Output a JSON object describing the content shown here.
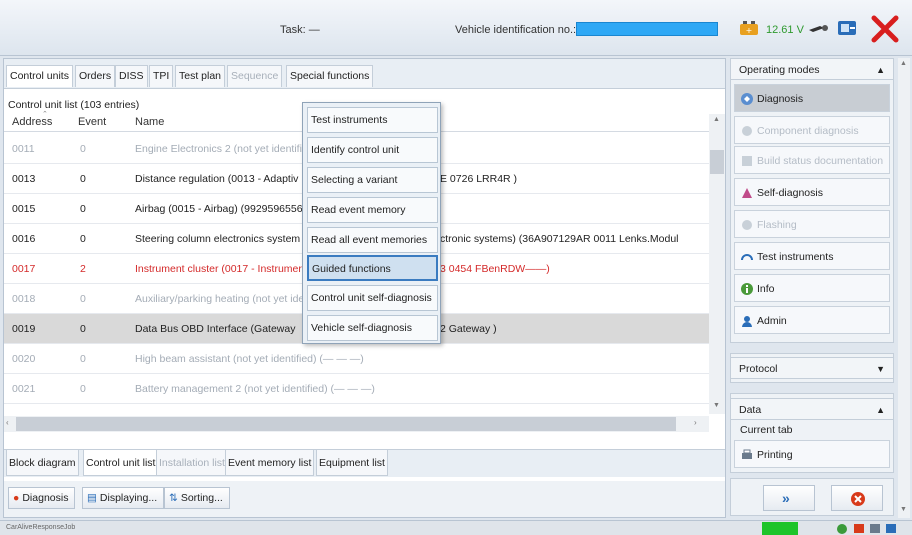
{
  "topbar": {
    "task_label": "Task:  —",
    "vin_label": "Vehicle identification no.:",
    "voltage": "12.61 V"
  },
  "tabs": [
    {
      "label": "Control units",
      "state": "active"
    },
    {
      "label": "Orders",
      "state": "normal"
    },
    {
      "label": "DISS",
      "state": "normal"
    },
    {
      "label": "TPI",
      "state": "normal"
    },
    {
      "label": "Test plan",
      "state": "normal"
    },
    {
      "label": "Sequence",
      "state": "disabled"
    },
    {
      "label": "Special functions",
      "state": "normal"
    }
  ],
  "list": {
    "title": "Control unit list (103 entries)",
    "headers": {
      "address": "Address",
      "event": "Event",
      "name": "Name"
    },
    "rows": [
      {
        "address": "0011",
        "event": "0",
        "name": "Engine Electronics 2 (not yet identifi",
        "extra": "",
        "style": "grey"
      },
      {
        "address": "0013",
        "event": "0",
        "name": "Distance regulation (0013 - Adaptiv",
        "extra": "E   0726  LRR4R     )",
        "style": "normal"
      },
      {
        "address": "0015",
        "event": "0",
        "name": "Airbag (0015 - Airbag) (9929596556",
        "extra": "",
        "style": "normal"
      },
      {
        "address": "0016",
        "event": "0",
        "name": "Steering column electronics system",
        "extra": "ctronic systems) (36A907129AR  0011  Lenks.Modul",
        "style": "normal"
      },
      {
        "address": "0017",
        "event": "2",
        "name": "Instrument cluster (0017 - Instrumer",
        "extra": "3   0454  FBenRDW——)",
        "style": "red"
      },
      {
        "address": "0018",
        "event": "0",
        "name": "Auxiliary/parking heating (not yet ide",
        "extra": "",
        "style": "grey"
      },
      {
        "address": "0019",
        "event": "0",
        "name": "Data Bus OBD Interface (Gateway",
        "extra": "2   Gateway    )",
        "style": "selected"
      },
      {
        "address": "0020",
        "event": "0",
        "name": "High beam assistant (not yet identified) (—  —  —)",
        "extra": "",
        "style": "grey"
      },
      {
        "address": "0021",
        "event": "0",
        "name": "Battery management 2 (not yet identified) (—  —  —)",
        "extra": "",
        "style": "grey"
      }
    ]
  },
  "popup_menu": [
    {
      "label": "Test instruments",
      "highlighted": false
    },
    {
      "label": "Identify control unit",
      "highlighted": false
    },
    {
      "label": "Selecting a variant",
      "highlighted": false
    },
    {
      "label": "Read event memory",
      "highlighted": false
    },
    {
      "label": "Read all event memories",
      "highlighted": false
    },
    {
      "label": "Guided functions",
      "highlighted": true
    },
    {
      "label": "Control unit self-diagnosis",
      "highlighted": false
    },
    {
      "label": "Vehicle self-diagnosis",
      "highlighted": false
    }
  ],
  "bottom_tabs": [
    {
      "label": "Block diagram",
      "state": "normal"
    },
    {
      "label": "Control unit list",
      "state": "active"
    },
    {
      "label": "Installation list",
      "state": "disabled"
    },
    {
      "label": "Event memory list",
      "state": "normal"
    },
    {
      "label": "Equipment list",
      "state": "normal"
    }
  ],
  "toolbar": {
    "diagnosis": "Diagnosis",
    "displaying": "Displaying...",
    "sorting": "Sorting..."
  },
  "right_panel": {
    "operating_modes": "Operating modes",
    "modes": [
      {
        "label": "Diagnosis",
        "state": "active"
      },
      {
        "label": "Component diagnosis",
        "state": "disabled"
      },
      {
        "label": "Build status documentation",
        "state": "disabled"
      },
      {
        "label": "Self-diagnosis",
        "state": "normal"
      },
      {
        "label": "Flashing",
        "state": "disabled"
      },
      {
        "label": "Test instruments",
        "state": "normal"
      },
      {
        "label": "Info",
        "state": "normal"
      },
      {
        "label": "Admin",
        "state": "normal"
      }
    ],
    "protocol": "Protocol",
    "data": "Data",
    "current_tab": "Current tab",
    "printing": "Printing"
  },
  "statusbar": {
    "text": "CarAliveResponseJob"
  },
  "colors": {
    "vin_box": "#2ea8f5",
    "voltage": "#2f9a2f",
    "error_row": "#d42a2a",
    "status_green": "#1dc42a",
    "highlight_border": "#3a7bc0"
  }
}
